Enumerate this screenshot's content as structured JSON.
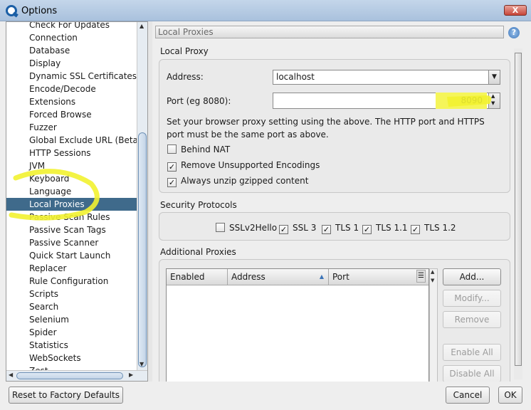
{
  "window": {
    "title": "Options",
    "close_label": "X"
  },
  "tree": {
    "items": [
      "Check For Updates",
      "Connection",
      "Database",
      "Display",
      "Dynamic SSL Certificates",
      "Encode/Decode",
      "Extensions",
      "Forced Browse",
      "Fuzzer",
      "Global Exclude URL (Beta)",
      "HTTP Sessions",
      "JVM",
      "Keyboard",
      "Language",
      "Local Proxies",
      "Passive Scan Rules",
      "Passive Scan Tags",
      "Passive Scanner",
      "Quick Start Launch",
      "Replacer",
      "Rule Configuration",
      "Scripts",
      "Search",
      "Selenium",
      "Spider",
      "Statistics",
      "WebSockets",
      "Zest"
    ],
    "selected": "Local Proxies"
  },
  "panel": {
    "header": "Local Proxies",
    "help_icon": "?"
  },
  "local_proxy": {
    "section_title": "Local Proxy",
    "address_label": "Address:",
    "address_value": "localhost",
    "port_label": "Port (eg 8080):",
    "port_value": "8090",
    "info": "Set your browser proxy setting using the above.  The HTTP port and HTTPS port must be the same port as above.",
    "behind_nat": {
      "label": "Behind NAT",
      "checked": false
    },
    "remove_unsupported": {
      "label": "Remove Unsupported Encodings",
      "checked": true
    },
    "always_unzip": {
      "label": "Always unzip gzipped content",
      "checked": true
    }
  },
  "security": {
    "section_title": "Security Protocols",
    "protocols": [
      {
        "label": "SSLv2Hello",
        "checked": false
      },
      {
        "label": "SSL 3",
        "checked": true
      },
      {
        "label": "TLS 1",
        "checked": true
      },
      {
        "label": "TLS 1.1",
        "checked": true
      },
      {
        "label": "TLS 1.2",
        "checked": true
      }
    ]
  },
  "additional": {
    "section_title": "Additional Proxies",
    "columns": [
      "Enabled",
      "Address",
      "Port"
    ],
    "buttons": {
      "add": "Add...",
      "modify": "Modify...",
      "remove": "Remove",
      "enable_all": "Enable All",
      "disable_all": "Disable All"
    }
  },
  "footer": {
    "reset": "Reset to Factory Defaults",
    "cancel": "Cancel",
    "ok": "OK"
  },
  "colors": {
    "selection": "#3f6a8b",
    "highlighter": "#f2f230",
    "accent": "#3c74b8"
  }
}
